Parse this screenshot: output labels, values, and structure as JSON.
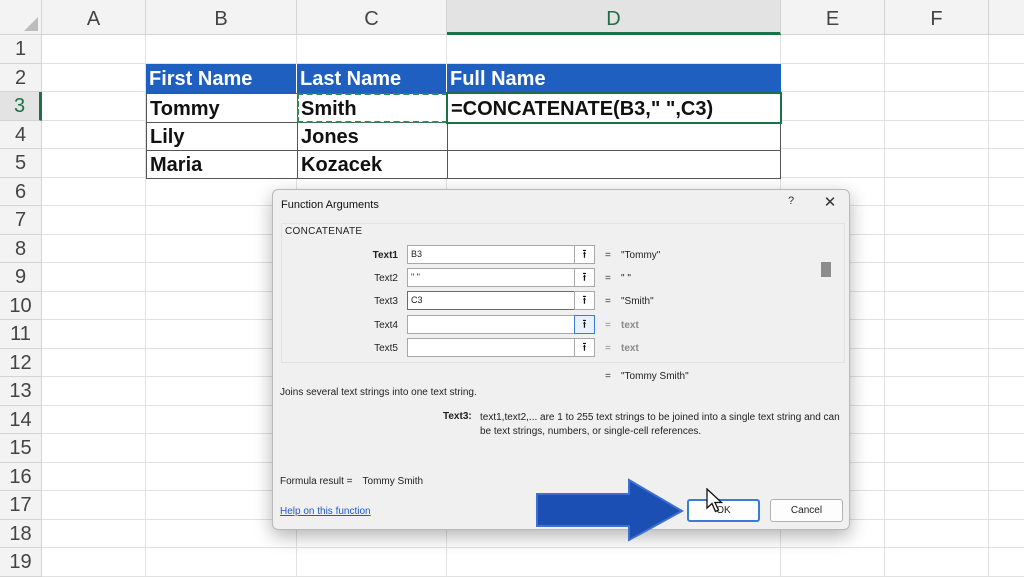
{
  "spreadsheet": {
    "columns": [
      "A",
      "B",
      "C",
      "D",
      "E",
      "F"
    ],
    "active_column": "D",
    "rows": [
      "1",
      "2",
      "3",
      "4",
      "5",
      "6",
      "7",
      "8",
      "9",
      "10",
      "11",
      "12",
      "13",
      "14",
      "15",
      "16",
      "17",
      "18",
      "19"
    ],
    "active_row": "3",
    "table": {
      "headers": [
        "First Name",
        "Last Name",
        "Full Name"
      ],
      "rows": [
        [
          "Tommy",
          "Smith",
          "=CONCATENATE(B3,\" \",C3)"
        ],
        [
          "Lily",
          "Jones",
          ""
        ],
        [
          "Maria",
          "Kozacek",
          ""
        ]
      ],
      "header_color": "#1f5fbf"
    }
  },
  "dialog": {
    "title": "Function Arguments",
    "help_label": "?",
    "close_label": "✕",
    "function_name": "CONCATENATE",
    "arguments": [
      {
        "label": "Text1",
        "value": "B3",
        "result": "\"Tommy\""
      },
      {
        "label": "Text2",
        "value": "\" \"",
        "result": "\" \""
      },
      {
        "label": "Text3",
        "value": "C3",
        "result": "\"Smith\""
      },
      {
        "label": "Text4",
        "value": "",
        "result": "text"
      },
      {
        "label": "Text5",
        "value": "",
        "result": "text"
      }
    ],
    "equals_sign": "=",
    "result_preview": "\"Tommy Smith\"",
    "description": "Joins several text strings into one text string.",
    "arg_description_label": "Text3:",
    "arg_description": "text1,text2,... are 1 to 255 text strings to be joined into a single text string and can be text strings, numbers, or single-cell references.",
    "formula_result_label": "Formula result =",
    "formula_result_value": "Tommy Smith",
    "help_link": "Help on this function",
    "ok_label": "OK",
    "cancel_label": "Cancel",
    "collapse_icon": "upload-arrow-icon"
  },
  "overlay": {
    "arrow_color": "#1b4fb3",
    "arrow_icon": "big-right-arrow-icon",
    "cursor_icon": "mouse-pointer-icon"
  }
}
